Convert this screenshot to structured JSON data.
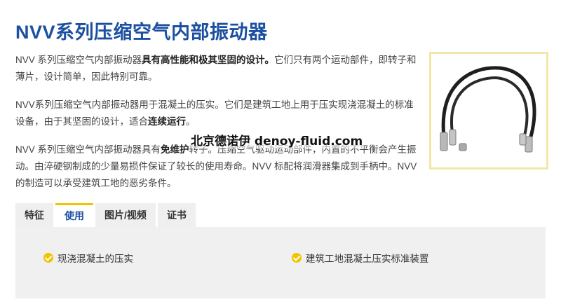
{
  "title": "NVV系列压缩空气内部振动器",
  "para1": {
    "a": "NVV 系列压缩空气内部振动器",
    "b": "具有高性能和极其坚固的设计。",
    "c": "它们只有两个运动部件，即转子和薄片，设计简单，因此特别可靠。"
  },
  "para2": {
    "a": "NVV系列压缩空气内部振动器用于混凝土的压实。它们是建筑工地上用于压实现浇混凝土的标准设备，由于其坚固的设计，适合",
    "b": "连续运行",
    "c": "。"
  },
  "para3": {
    "a": "NVV 系列压缩空气内部振动器具有",
    "b": "免维护",
    "c": "转子。压缩空气驱动运动部件，内置的不平衡会产生振动。由淬硬钢制成的少量易损件保证了较长的使用寿命。NVV 标配将润滑器集成到手柄中。NVV 的制造可以承受建筑工地的恶劣条件。"
  },
  "watermark": "北京德诺伊 denoy-fluid.com",
  "tabs": [
    "特征",
    "使用",
    "图片/视频",
    "证书"
  ],
  "active_tab": "使用",
  "features": [
    "现浇混凝土的压实",
    "建筑工地混凝土压实标准装置"
  ],
  "colors": {
    "title": "#1b4fa0",
    "accent_yellow": "#f1c400",
    "panel_bg": "#f0f0f0",
    "tab_bg": "#efefef",
    "image_border": "#f2e7a6"
  },
  "icons": {
    "feature_bullet": "check-circle-icon",
    "product_image": "hose-vibrator-image"
  }
}
